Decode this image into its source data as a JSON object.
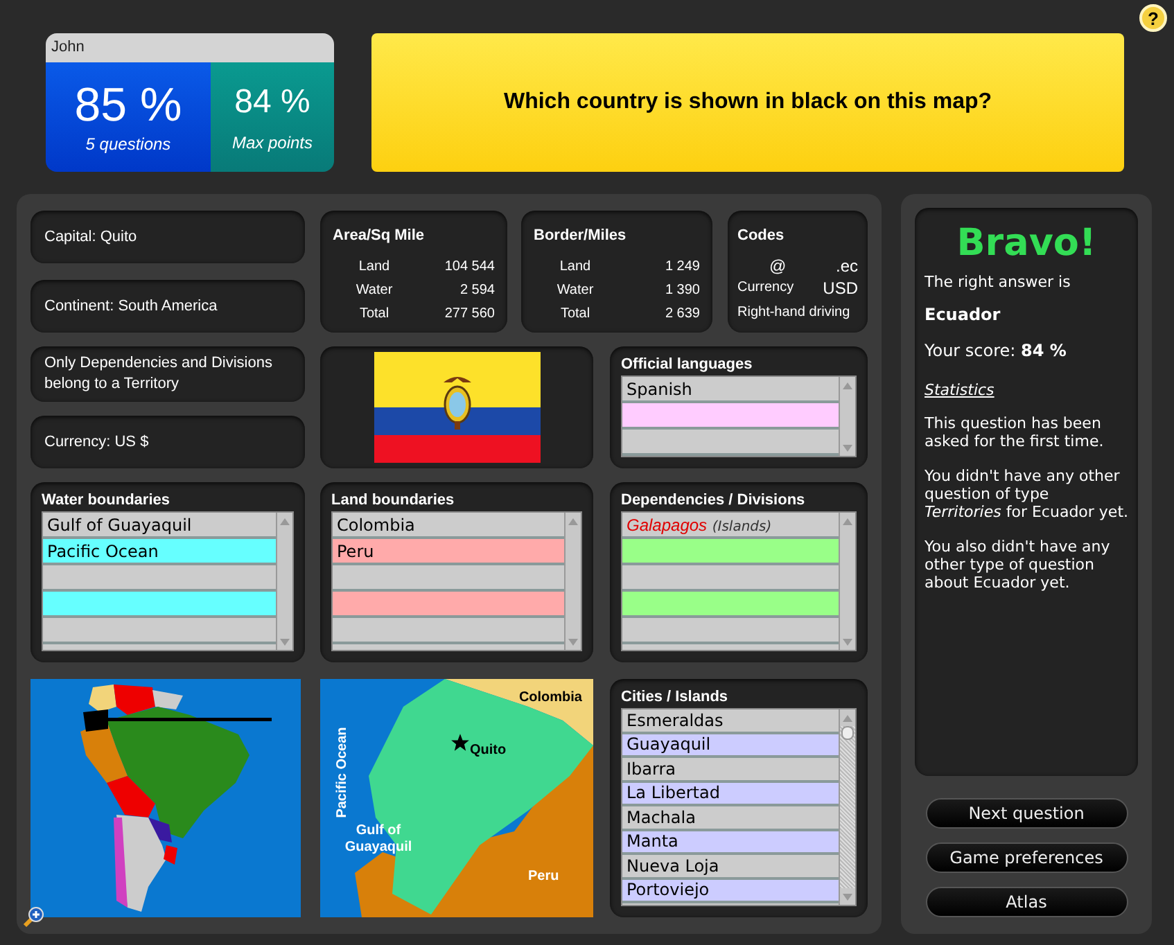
{
  "help_button": {
    "label": "?"
  },
  "score_card": {
    "player": "John",
    "score": "85 %",
    "score_caption": "5 questions",
    "max": "84 %",
    "max_caption": "Max points"
  },
  "question": "Which country is shown in black on this map?",
  "capital": "Capital: Quito",
  "continent": "Continent: South America",
  "territory_note": "Only Dependencies and Divisions belong to a Territory",
  "currency": "Currency: US $",
  "area": {
    "title": "Area/Sq Mile",
    "rows": [
      {
        "label": "Land",
        "value": "104 544"
      },
      {
        "label": "Water",
        "value": "2 594"
      },
      {
        "label": "Total",
        "value": "277 560"
      }
    ]
  },
  "border": {
    "title": "Border/Miles",
    "rows": [
      {
        "label": "Land",
        "value": "1 249"
      },
      {
        "label": "Water",
        "value": "1 390"
      },
      {
        "label": "Total",
        "value": "2 639"
      }
    ]
  },
  "codes": {
    "title": "Codes",
    "rows": [
      {
        "label": "@",
        "value": ".ec"
      },
      {
        "label": "Currency",
        "value": "USD"
      }
    ],
    "driving": "Right-hand driving"
  },
  "languages": {
    "title": "Official languages",
    "rows": [
      {
        "text": "Spanish",
        "color": "#cccccc"
      },
      {
        "color": "#ffccff"
      },
      {
        "color": "#cccccc"
      }
    ]
  },
  "water_boundaries": {
    "title": "Water boundaries",
    "rows": [
      {
        "text": "Gulf of Guayaquil",
        "color": "#cccccc"
      },
      {
        "text": "Pacific Ocean",
        "color": "#66ffff"
      },
      {
        "color": "#cccccc"
      },
      {
        "color": "#66ffff"
      },
      {
        "color": "#cccccc"
      }
    ]
  },
  "land_boundaries": {
    "title": "Land boundaries",
    "rows": [
      {
        "text": "Colombia",
        "color": "#cccccc"
      },
      {
        "text": "Peru",
        "color": "#ffaaaa"
      },
      {
        "color": "#cccccc"
      },
      {
        "color": "#ffaaaa"
      },
      {
        "color": "#cccccc"
      }
    ]
  },
  "dependencies": {
    "title": "Dependencies / Divisions",
    "rows": [
      {
        "text": "Galapagos",
        "note": "(Islands)",
        "color": "#cccccc"
      },
      {
        "color": "#99ff88"
      },
      {
        "color": "#cccccc"
      },
      {
        "color": "#99ff88"
      },
      {
        "color": "#cccccc"
      }
    ]
  },
  "detail_map": {
    "labels": [
      "Colombia",
      "Pacific Ocean",
      "Quito",
      "Gulf of Guayaquil",
      "Peru"
    ]
  },
  "cities": {
    "title": "Cities / Islands",
    "rows": [
      {
        "text": "Esmeraldas",
        "color": "#cccccc"
      },
      {
        "text": "Guayaquil",
        "color": "#ccccff"
      },
      {
        "text": "Ibarra",
        "color": "#cccccc"
      },
      {
        "text": "La Libertad",
        "color": "#ccccff"
      },
      {
        "text": "Machala",
        "color": "#cccccc"
      },
      {
        "text": "Manta",
        "color": "#ccccff"
      },
      {
        "text": "Nueva Loja",
        "color": "#cccccc"
      },
      {
        "text": "Portoviejo",
        "color": "#ccccff"
      }
    ]
  },
  "result": {
    "headline": "Bravo!",
    "intro": "The right answer is",
    "answer": "Ecuador",
    "score": "Your score: **84 %**",
    "stats_link": "Statistics",
    "paragraphs": [
      "This question has been asked for the first time.",
      "You didn't have any other question of type *Territories* for Ecuador yet.",
      "You also didn't have any other type of question about Ecuador yet."
    ]
  },
  "buttons": [
    "Next question",
    "Game preferences",
    "Atlas"
  ]
}
